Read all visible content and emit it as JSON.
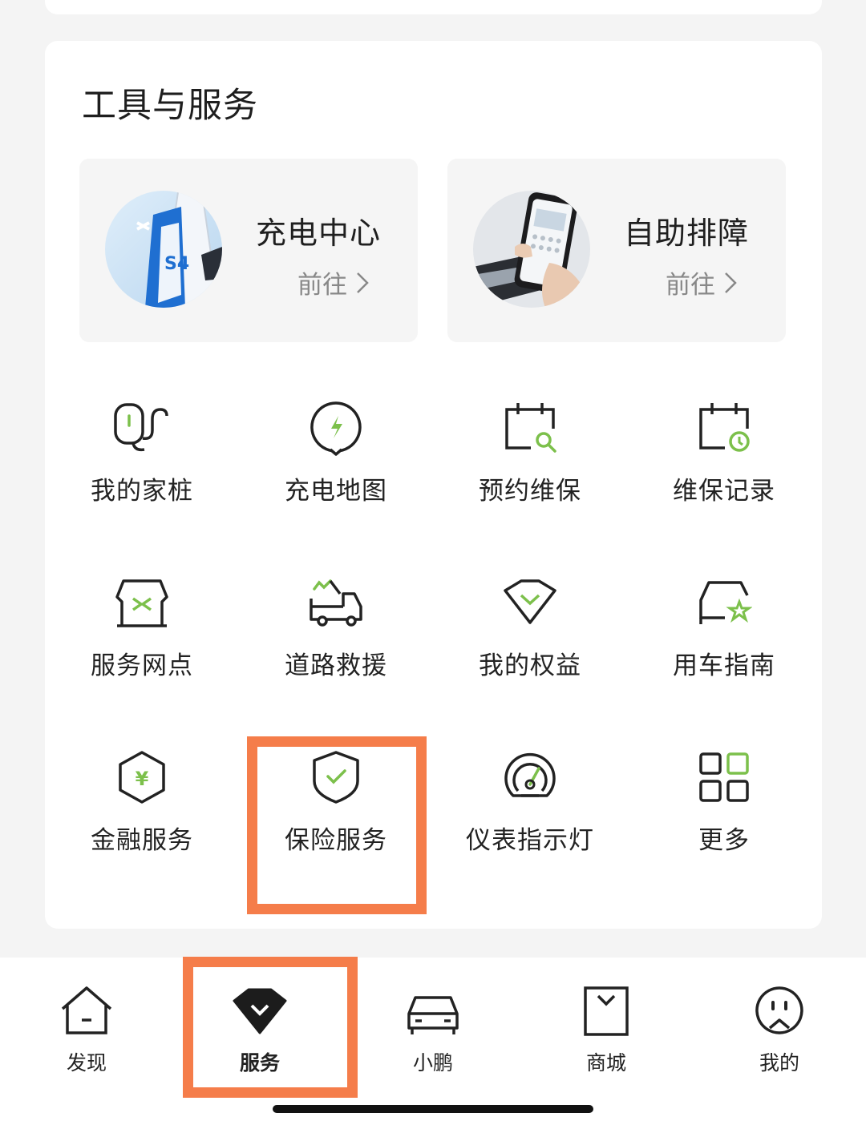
{
  "section": {
    "title": "工具与服务"
  },
  "features": [
    {
      "title": "充电中心",
      "go": "前往",
      "icon": "charging-station-photo"
    },
    {
      "title": "自助排障",
      "go": "前往",
      "icon": "phone-in-hand-photo"
    }
  ],
  "grid": [
    {
      "label": "我的家桩",
      "icon": "home-charger-icon"
    },
    {
      "label": "充电地图",
      "icon": "charge-map-icon"
    },
    {
      "label": "预约维保",
      "icon": "calendar-search-icon"
    },
    {
      "label": "维保记录",
      "icon": "calendar-clock-icon"
    },
    {
      "label": "服务网点",
      "icon": "service-store-icon"
    },
    {
      "label": "道路救援",
      "icon": "tow-truck-icon"
    },
    {
      "label": "我的权益",
      "icon": "diamond-icon"
    },
    {
      "label": "用车指南",
      "icon": "car-star-icon"
    },
    {
      "label": "金融服务",
      "icon": "yuan-hexagon-icon"
    },
    {
      "label": "保险服务",
      "icon": "shield-check-icon"
    },
    {
      "label": "仪表指示灯",
      "icon": "gauge-icon"
    },
    {
      "label": "更多",
      "icon": "grid-more-icon"
    }
  ],
  "tabs": [
    {
      "label": "发现",
      "icon": "home-icon",
      "active": false
    },
    {
      "label": "服务",
      "icon": "diamond-tab-icon",
      "active": true
    },
    {
      "label": "小鹏",
      "icon": "car-icon",
      "active": false
    },
    {
      "label": "商城",
      "icon": "bag-icon",
      "active": false
    },
    {
      "label": "我的",
      "icon": "profile-face-icon",
      "active": false
    }
  ],
  "colors": {
    "accent": "#7cc04b",
    "highlight": "#f57d4a",
    "text": "#222222"
  }
}
